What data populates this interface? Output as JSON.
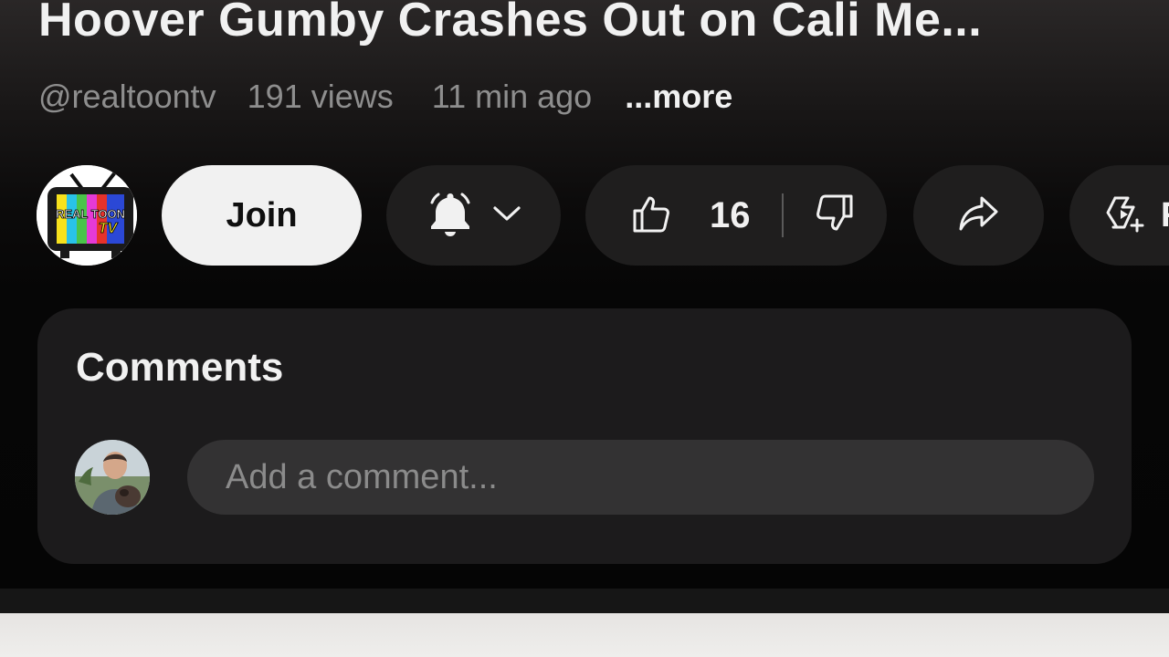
{
  "video": {
    "title": "Hoover Gumby Crashes Out on Cali Me...",
    "channel_handle": "@realtoontv",
    "views": "191 views",
    "time_ago": "11 min ago",
    "more_label": "...more"
  },
  "actions": {
    "join_label": "Join",
    "like_count": "16",
    "remix_label_partial": "R"
  },
  "channel_logo": {
    "text_line1": "REAL TOON",
    "text_line2": "TV"
  },
  "comments": {
    "title": "Comments",
    "input_placeholder": "Add a comment..."
  },
  "icons": {
    "bell": "bell-icon",
    "chevron": "chevron-down-icon",
    "like": "thumbs-up-icon",
    "dislike": "thumbs-down-icon",
    "share": "share-arrow-icon",
    "remix": "remix-icon"
  },
  "colors": {
    "background": "#050505",
    "pill": "#1f1e1e",
    "join_pill": "#f1f1f1",
    "comments_panel": "#1c1b1c",
    "comment_input": "#333233",
    "text_primary": "#f1f1f1",
    "text_secondary": "#8e8e8e"
  }
}
